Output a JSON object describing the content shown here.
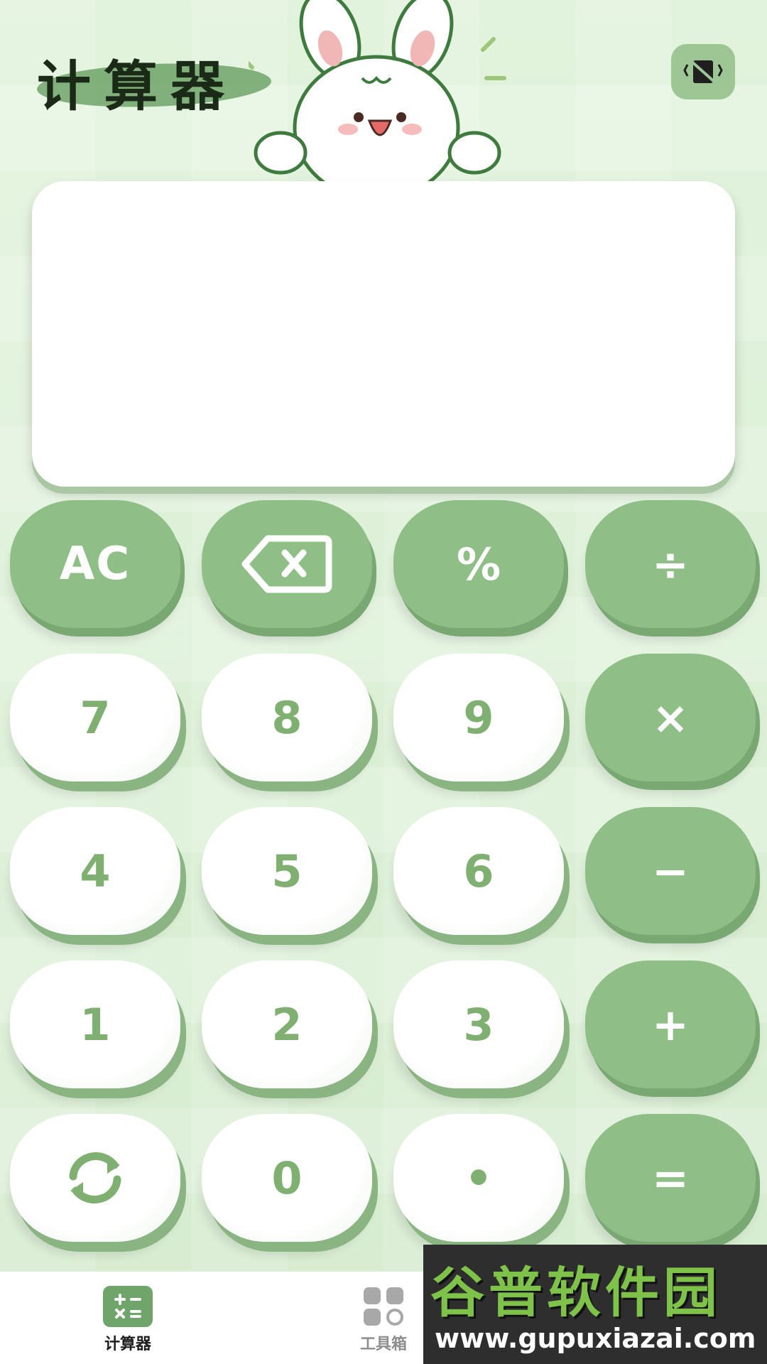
{
  "header": {
    "title": "计算器"
  },
  "display": {
    "value": ""
  },
  "keypad": {
    "rows": [
      [
        {
          "label": "AC",
          "name": "clear-button",
          "style": "green"
        },
        {
          "label": "",
          "name": "backspace-button",
          "style": "green",
          "icon": "backspace-icon"
        },
        {
          "label": "%",
          "name": "percent-button",
          "style": "green"
        },
        {
          "label": "÷",
          "name": "divide-button",
          "style": "green"
        }
      ],
      [
        {
          "label": "7",
          "name": "digit-7-button",
          "style": "white"
        },
        {
          "label": "8",
          "name": "digit-8-button",
          "style": "white"
        },
        {
          "label": "9",
          "name": "digit-9-button",
          "style": "white"
        },
        {
          "label": "×",
          "name": "multiply-button",
          "style": "green"
        }
      ],
      [
        {
          "label": "4",
          "name": "digit-4-button",
          "style": "white"
        },
        {
          "label": "5",
          "name": "digit-5-button",
          "style": "white"
        },
        {
          "label": "6",
          "name": "digit-6-button",
          "style": "white"
        },
        {
          "label": "−",
          "name": "subtract-button",
          "style": "green"
        }
      ],
      [
        {
          "label": "1",
          "name": "digit-1-button",
          "style": "white"
        },
        {
          "label": "2",
          "name": "digit-2-button",
          "style": "white"
        },
        {
          "label": "3",
          "name": "digit-3-button",
          "style": "white"
        },
        {
          "label": "+",
          "name": "add-button",
          "style": "green"
        }
      ],
      [
        {
          "label": "",
          "name": "toggle-sign-button",
          "style": "white",
          "icon": "refresh-icon"
        },
        {
          "label": "0",
          "name": "digit-0-button",
          "style": "white"
        },
        {
          "label": "•",
          "name": "decimal-point-button",
          "style": "white"
        },
        {
          "label": "=",
          "name": "equals-button",
          "style": "green"
        }
      ]
    ]
  },
  "tabbar": {
    "tabs": [
      {
        "label": "计算器",
        "icon": "calculator-icon",
        "active": true
      },
      {
        "label": "工具箱",
        "icon": "grid-icon",
        "active": false
      }
    ]
  },
  "watermark": {
    "title": "谷普软件园",
    "url": "www.gupuxiazai.com"
  },
  "colors": {
    "accent": "#8fbf87",
    "key_text": "#7fb071",
    "background": "#dcefd6"
  }
}
